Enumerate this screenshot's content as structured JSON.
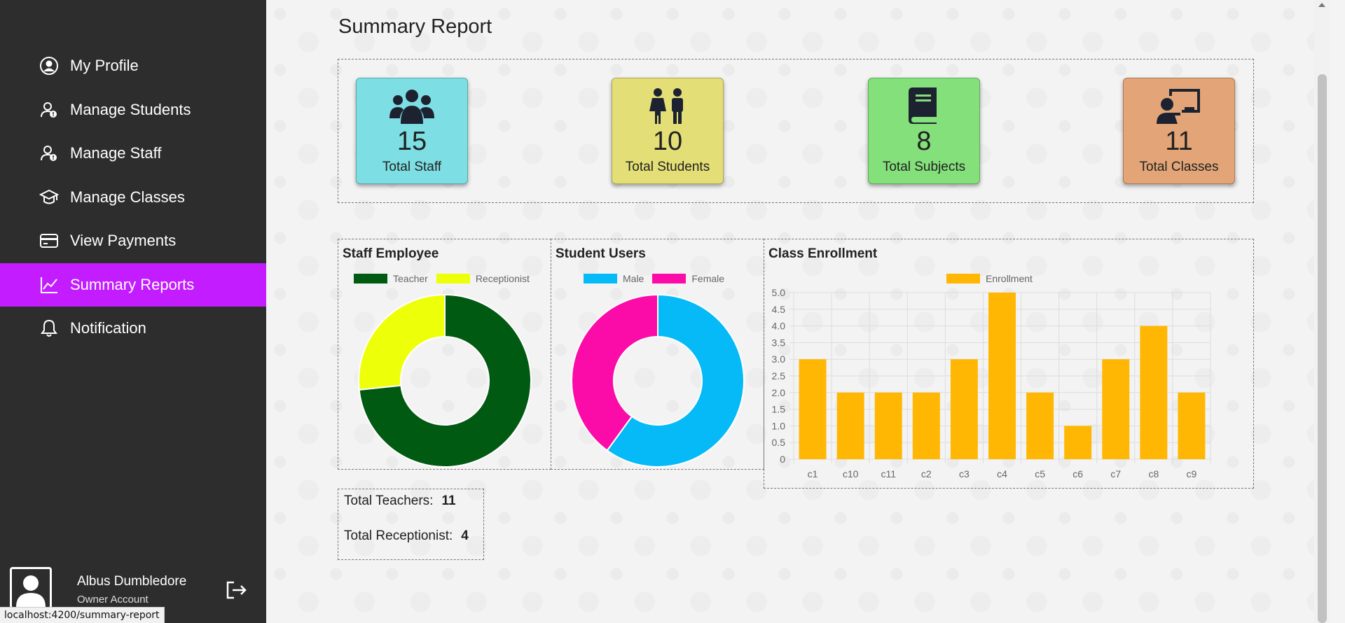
{
  "sidebar": {
    "items": [
      {
        "label": "My Profile",
        "icon": "user-circle-icon",
        "active": false
      },
      {
        "label": "Manage Students",
        "icon": "user-alert-icon",
        "active": false
      },
      {
        "label": "Manage Staff",
        "icon": "user-alert-icon",
        "active": false
      },
      {
        "label": "Manage Classes",
        "icon": "graduation-cap-icon",
        "active": false
      },
      {
        "label": "View Payments",
        "icon": "credit-card-icon",
        "active": false
      },
      {
        "label": "Summary Reports",
        "icon": "line-chart-icon",
        "active": true
      },
      {
        "label": "Notification",
        "icon": "bell-icon",
        "active": false
      }
    ],
    "active_color": "#c21cff",
    "user": {
      "name": "Albus Dumbledore",
      "role": "Owner Account"
    }
  },
  "status_bar": {
    "url": "localhost:4200/summary-report"
  },
  "page": {
    "title": "Summary Report"
  },
  "stats": [
    {
      "value": "15",
      "label": "Total Staff",
      "color": "#7ddfe3",
      "icon": "group-icon"
    },
    {
      "value": "10",
      "label": "Total Students",
      "color": "#e3df76",
      "icon": "children-icon"
    },
    {
      "value": "8",
      "label": "Total Subjects",
      "color": "#84e07a",
      "icon": "book-icon"
    },
    {
      "value": "11",
      "label": "Total Classes",
      "color": "#e3a577",
      "icon": "teacher-board-icon"
    }
  ],
  "panels": {
    "staff": {
      "title": "Staff Employee"
    },
    "students": {
      "title": "Student Users"
    },
    "enrollment": {
      "title": "Class Enrollment"
    }
  },
  "totals": {
    "teachers_label": "Total Teachers:",
    "teachers_value": "11",
    "receptionist_label": "Total Receptionist:",
    "receptionist_value": "4"
  },
  "chart_data": [
    {
      "type": "pie",
      "title": "Staff Employee",
      "categories": [
        "Teacher",
        "Receptionist"
      ],
      "values": [
        11,
        4
      ],
      "colors": [
        "#015a11",
        "#eeff0a"
      ],
      "legend": "top"
    },
    {
      "type": "pie",
      "title": "Student Users",
      "categories": [
        "Male",
        "Female"
      ],
      "values": [
        6,
        4
      ],
      "colors": [
        "#06baf7",
        "#fb0ba8"
      ],
      "legend": "top"
    },
    {
      "type": "bar",
      "title": "Class Enrollment",
      "categories": [
        "c1",
        "c10",
        "c11",
        "c2",
        "c3",
        "c4",
        "c5",
        "c6",
        "c7",
        "c8",
        "c9"
      ],
      "series": [
        {
          "name": "Enrollment",
          "values": [
            3,
            2,
            2,
            2,
            3,
            5,
            2,
            1,
            3,
            4,
            2
          ]
        }
      ],
      "ylim": [
        0,
        5
      ],
      "yticks": [
        "0",
        "0.5",
        "1.0",
        "1.5",
        "2.0",
        "2.5",
        "3.0",
        "3.5",
        "4.0",
        "4.5",
        "5.0"
      ],
      "color": "#ffb703",
      "grid": true,
      "legend": "top"
    }
  ]
}
